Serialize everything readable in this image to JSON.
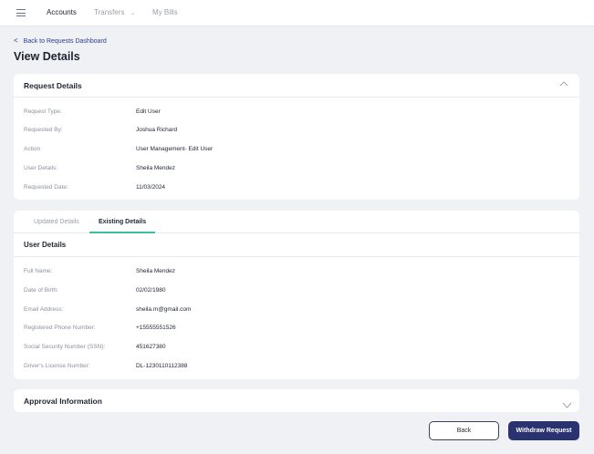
{
  "nav": {
    "items": [
      "Accounts",
      "Transfers",
      "My Bills"
    ]
  },
  "back_link": "Back to Requests Dashboard",
  "page_title": "View Details",
  "request_details": {
    "title": "Request Details",
    "rows": [
      {
        "label": "Request Type:",
        "value": "Edit User"
      },
      {
        "label": "Requested By:",
        "value": "Joshua Richard"
      },
      {
        "label": "Action",
        "value": "User Management- Edit User"
      },
      {
        "label": "User Details:",
        "value": "Sheila Mendez"
      },
      {
        "label": "Requested Date:",
        "value": "11/03/2024"
      }
    ]
  },
  "tabs": [
    "Updated Details",
    "Existing Details"
  ],
  "user_details": {
    "title": "User Details",
    "rows": [
      {
        "label": "Full Name:",
        "value": "Sheila Mendez"
      },
      {
        "label": "Date of Birth:",
        "value": "02/02/1980"
      },
      {
        "label": "Email Address:",
        "value": "sheila.m@gmail.com"
      },
      {
        "label": "Registered Phone Number:",
        "value": "+15555551526"
      },
      {
        "label": "Social Security Number (SSN):",
        "value": "451627380"
      },
      {
        "label": "Driver's License Number:",
        "value": "DL-1230110112388"
      }
    ]
  },
  "approval": {
    "title": "Approval Information"
  },
  "buttons": {
    "back": "Back",
    "withdraw": "Withdraw Request"
  }
}
